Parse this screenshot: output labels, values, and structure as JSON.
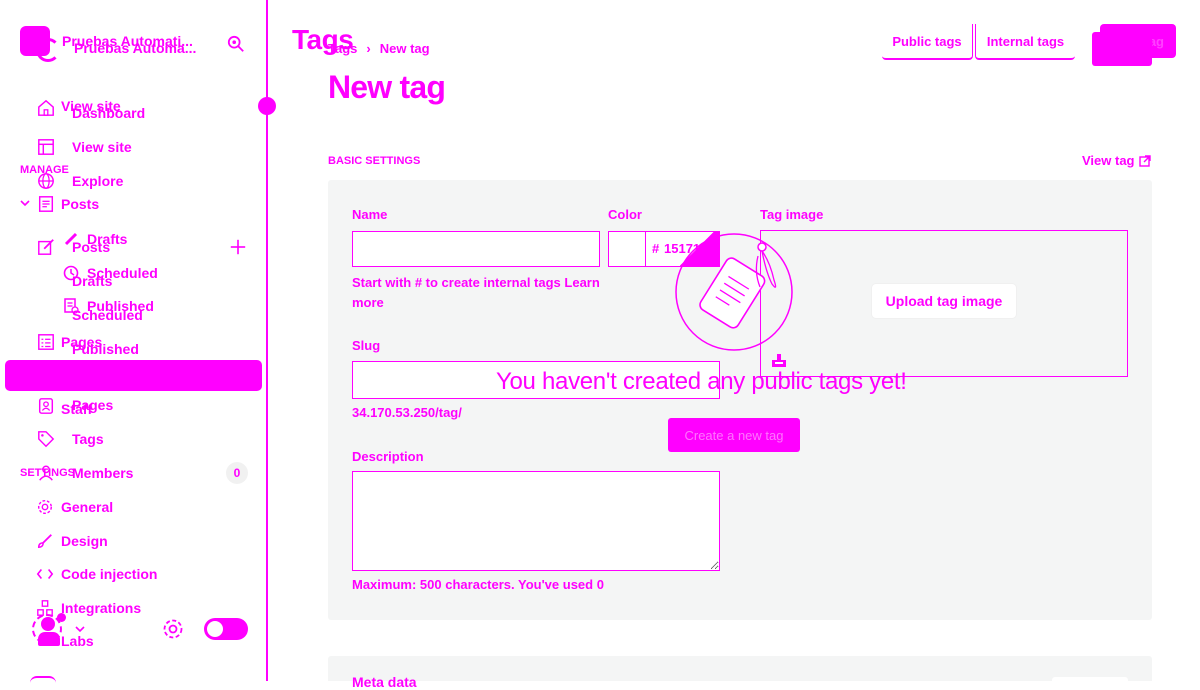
{
  "colors": {
    "accent": "#ff00ff",
    "panel_bg": "#f4f5f5"
  },
  "sidebar": {
    "site_title_a": "Pruebas Automati...",
    "site_title_b": "Pruebas Automa...",
    "top_items": [
      {
        "label": "View site",
        "icon": "home-icon"
      },
      {
        "label": "Dashboard",
        "icon": "home-icon"
      },
      {
        "label": "View site",
        "icon": "layout-icon"
      },
      {
        "label": "Explore",
        "icon": "globe-icon"
      }
    ],
    "manage_heading": "MANAGE",
    "posts_group": {
      "label": "Posts",
      "label_b": "Posts",
      "drafts_a": "Drafts",
      "drafts_b": "Drafts",
      "scheduled_a": "Scheduled",
      "scheduled_b": "Scheduled",
      "published_a": "Published",
      "published_b": "Published"
    },
    "pages_a": "Pages",
    "pages_b": "Pages",
    "staff": "Staff",
    "tags": "Tags",
    "members": "Members",
    "members_count": "0",
    "settings_heading": "SETTINGS",
    "settings_items": [
      {
        "label": "General",
        "icon": "gear-icon"
      },
      {
        "label": "Design",
        "icon": "brush-icon"
      },
      {
        "label": "Code injection",
        "icon": "code-icon"
      },
      {
        "label": "Integrations",
        "icon": "integrations-icon"
      }
    ],
    "labs": "Labs"
  },
  "header": {
    "page_heading": "Tags",
    "breadcrumb_parent": "Tags",
    "breadcrumb_current": "New tag",
    "tab_public": "Public tags",
    "tab_internal": "Internal tags",
    "new_tag_button": "New tag"
  },
  "main": {
    "title": "New tag",
    "section_heading": "BASIC SETTINGS",
    "view_tag_link": "View tag",
    "name_label": "Name",
    "name_value": "",
    "name_help": "Start with # to create internal tags",
    "learn_more": "Learn more",
    "color_label": "Color",
    "color_value": "151719",
    "color_prefix": "#",
    "tag_image_label": "Tag image",
    "upload_button": "Upload tag image",
    "slug_label": "Slug",
    "slug_value": "",
    "url_preview": "34.170.53.250/tag/",
    "description_label": "Description",
    "description_value": "",
    "max_chars_prefix": "Maximum:",
    "max_chars_value": "500",
    "used_text": "characters. You've used",
    "used_value": "0",
    "meta_heading": "Meta data"
  },
  "empty_state": {
    "message": "You haven't created any public tags yet!",
    "button": "Create a new tag"
  }
}
